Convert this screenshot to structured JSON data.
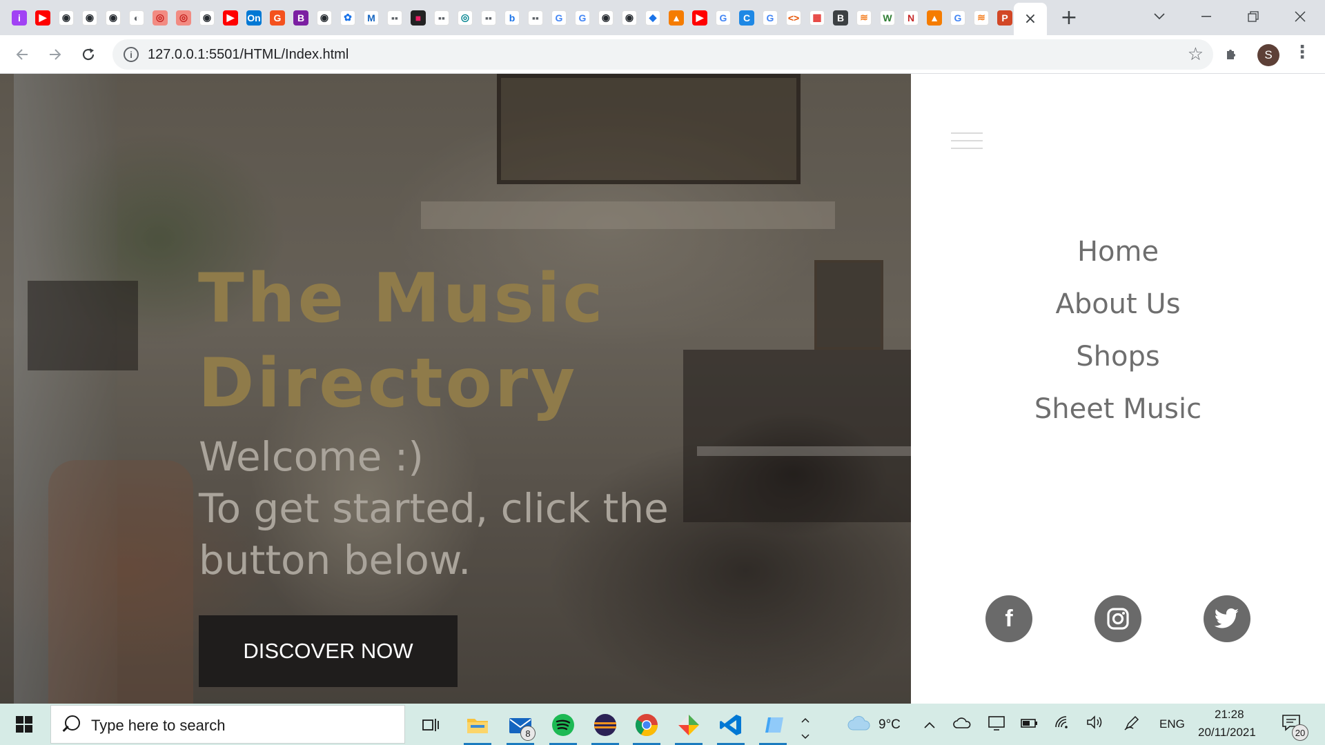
{
  "browser": {
    "url": "127.0.0.1:5501/HTML/Index.html",
    "profile_initial": "S",
    "tab_close_glyph": "×",
    "new_tab_glyph": "+",
    "favicons": [
      {
        "glyph": "i",
        "bg": "#a142f4",
        "fg": "#fff"
      },
      {
        "glyph": "▶",
        "bg": "#ff0000",
        "fg": "#fff"
      },
      {
        "glyph": "◉",
        "bg": "#ffffff",
        "fg": "#24292e"
      },
      {
        "glyph": "◉",
        "bg": "#ffffff",
        "fg": "#24292e"
      },
      {
        "glyph": "◉",
        "bg": "#ffffff",
        "fg": "#24292e"
      },
      {
        "glyph": "◐",
        "bg": "#ffffff",
        "fg": "#5f6368"
      },
      {
        "glyph": "◎",
        "bg": "#f28b82",
        "fg": "#c5221f"
      },
      {
        "glyph": "◎",
        "bg": "#f28b82",
        "fg": "#c5221f"
      },
      {
        "glyph": "◉",
        "bg": "#ffffff",
        "fg": "#24292e"
      },
      {
        "glyph": "▶",
        "bg": "#ff0000",
        "fg": "#fff"
      },
      {
        "glyph": "On",
        "bg": "#0078d4",
        "fg": "#fff"
      },
      {
        "glyph": "G",
        "bg": "#f4511e",
        "fg": "#fff"
      },
      {
        "glyph": "B",
        "bg": "#7b1fa2",
        "fg": "#fff"
      },
      {
        "glyph": "◉",
        "bg": "#ffffff",
        "fg": "#24292e"
      },
      {
        "glyph": "✿",
        "bg": "#ffffff",
        "fg": "#1a73e8"
      },
      {
        "glyph": "M",
        "bg": "#ffffff",
        "fg": "#1565c0"
      },
      {
        "glyph": "▪▪",
        "bg": "#ffffff",
        "fg": "#5f6368"
      },
      {
        "glyph": "■",
        "bg": "#222222",
        "fg": "#e91e63"
      },
      {
        "glyph": "▪▪",
        "bg": "#ffffff",
        "fg": "#5f6368"
      },
      {
        "glyph": "◎",
        "bg": "#ffffff",
        "fg": "#00838f"
      },
      {
        "glyph": "▪▪",
        "bg": "#ffffff",
        "fg": "#5f6368"
      },
      {
        "glyph": "b",
        "bg": "#ffffff",
        "fg": "#1a73e8"
      },
      {
        "glyph": "▪▪",
        "bg": "#ffffff",
        "fg": "#5f6368"
      },
      {
        "glyph": "G",
        "bg": "#ffffff",
        "fg": "#4285f4"
      },
      {
        "glyph": "G",
        "bg": "#ffffff",
        "fg": "#4285f4"
      },
      {
        "glyph": "◉",
        "bg": "#ffffff",
        "fg": "#24292e"
      },
      {
        "glyph": "◉",
        "bg": "#ffffff",
        "fg": "#24292e"
      },
      {
        "glyph": "◆",
        "bg": "#ffffff",
        "fg": "#1a73e8"
      },
      {
        "glyph": "▲",
        "bg": "#f57c00",
        "fg": "#fff"
      },
      {
        "glyph": "▶",
        "bg": "#ff0000",
        "fg": "#fff"
      },
      {
        "glyph": "G",
        "bg": "#ffffff",
        "fg": "#4285f4"
      },
      {
        "glyph": "C",
        "bg": "#1e88e5",
        "fg": "#fff"
      },
      {
        "glyph": "G",
        "bg": "#ffffff",
        "fg": "#4285f4"
      },
      {
        "glyph": "<>",
        "bg": "#ffffff",
        "fg": "#e65100"
      },
      {
        "glyph": "▦",
        "bg": "#ffffff",
        "fg": "#e53935"
      },
      {
        "glyph": "B",
        "bg": "#3c4043",
        "fg": "#fff"
      },
      {
        "glyph": "≋",
        "bg": "#ffffff",
        "fg": "#f48024"
      },
      {
        "glyph": "W",
        "bg": "#ffffff",
        "fg": "#2e7d32"
      },
      {
        "glyph": "N",
        "bg": "#ffffff",
        "fg": "#c62828"
      },
      {
        "glyph": "▲",
        "bg": "#f57c00",
        "fg": "#fff"
      },
      {
        "glyph": "G",
        "bg": "#ffffff",
        "fg": "#4285f4"
      },
      {
        "glyph": "≋",
        "bg": "#ffffff",
        "fg": "#f48024"
      },
      {
        "glyph": "P",
        "bg": "#d24726",
        "fg": "#fff"
      }
    ]
  },
  "page": {
    "title_line1": "The Music",
    "title_line2": "Directory",
    "welcome": "Welcome :)",
    "instructions": "To get started, click the button below.",
    "cta": "DISCOVER NOW",
    "nav": [
      "Home",
      "About Us",
      "Shops",
      "Sheet Music"
    ],
    "social": [
      {
        "name": "facebook",
        "glyph": "f"
      },
      {
        "name": "instagram",
        "glyph": "◎"
      },
      {
        "name": "twitter",
        "glyph": "🐦"
      }
    ]
  },
  "taskbar": {
    "search_placeholder": "Type here to search",
    "mail_badge": "8",
    "weather": "9°C",
    "language": "ENG",
    "time": "21:28",
    "date": "20/11/2021",
    "notifications": "20"
  }
}
